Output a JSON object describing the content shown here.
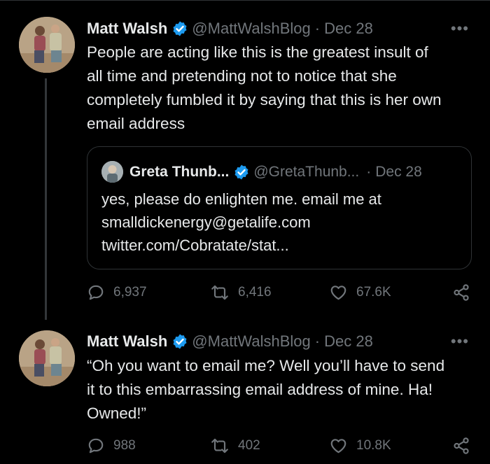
{
  "tweets": [
    {
      "author": "Matt Walsh",
      "handle": "@MattWalshBlog",
      "separator": "·",
      "date": "Dec 28",
      "more": "•••",
      "text_lines": [
        "People are acting like this is the greatest insult of",
        "all time and pretending not to notice that she",
        "completely fumbled it by saying that this is her own",
        "email address"
      ],
      "quote": {
        "author": "Greta Thunb...",
        "handle": "@GretaThunb...",
        "separator": "·",
        "date": "Dec 28",
        "text_lines": [
          "yes, please do enlighten me. email me at",
          "smalldickenergy@getalife.com",
          "twitter.com/Cobratate/stat..."
        ]
      },
      "replies": "6,937",
      "retweets": "6,416",
      "likes": "67.6K"
    },
    {
      "author": "Matt Walsh",
      "handle": "@MattWalshBlog",
      "separator": "·",
      "date": "Dec 28",
      "more": "•••",
      "text_lines": [
        "“Oh you want to email me? Well you’ll have to send",
        "it to this embarrassing email address of mine. Ha!",
        "Owned!”"
      ],
      "replies": "988",
      "retweets": "402",
      "likes": "10.8K"
    }
  ],
  "colors": {
    "background": "#000000",
    "text": "#e7e9ea",
    "secondary": "#71767b",
    "verified": "#1d9bf0",
    "border": "#2f3336"
  },
  "icons": [
    "verified-badge-icon",
    "more-icon",
    "reply-icon",
    "retweet-icon",
    "like-icon",
    "share-icon"
  ]
}
